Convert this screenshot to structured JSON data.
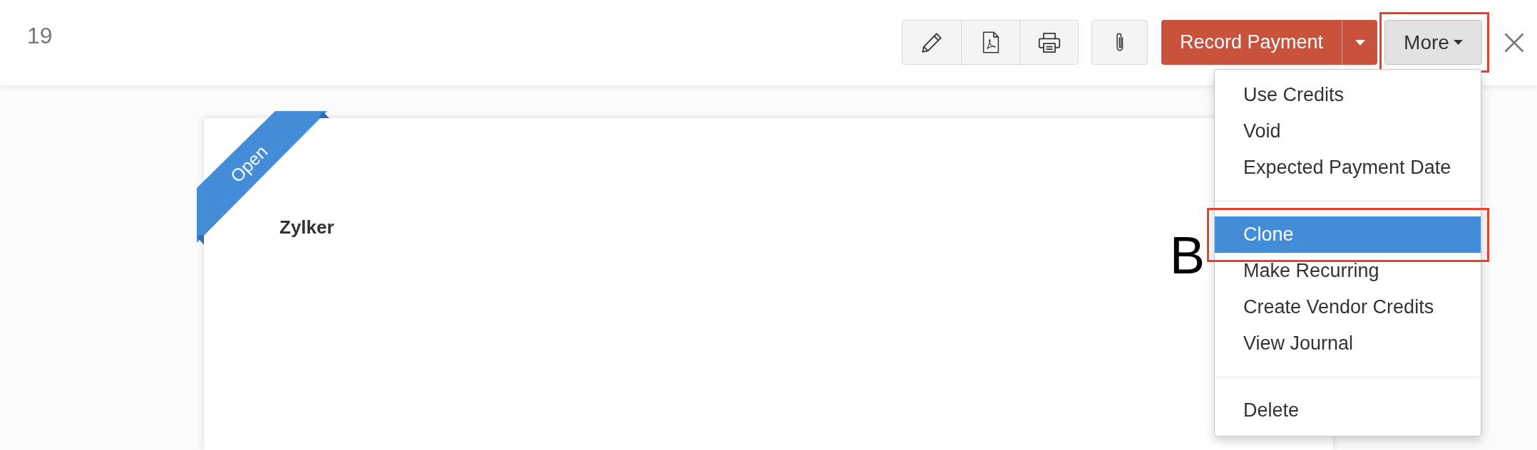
{
  "header": {
    "title": "19"
  },
  "actions": {
    "record_payment": {
      "label": "Record Payment"
    },
    "more": {
      "label": "More",
      "highlighted": true
    }
  },
  "more_menu": {
    "sections": [
      {
        "items": [
          {
            "label": "Use Credits",
            "selected": false,
            "highlighted": false
          },
          {
            "label": "Void",
            "selected": false,
            "highlighted": false
          },
          {
            "label": "Expected Payment Date",
            "selected": false,
            "highlighted": false
          }
        ]
      },
      {
        "items": [
          {
            "label": "Clone",
            "selected": true,
            "highlighted": true,
            "callout": "B"
          },
          {
            "label": "Make Recurring",
            "selected": false,
            "highlighted": false
          },
          {
            "label": "Create Vendor Credits",
            "selected": false,
            "highlighted": false
          },
          {
            "label": "View Journal",
            "selected": false,
            "highlighted": false
          }
        ]
      },
      {
        "items": [
          {
            "label": "Delete",
            "selected": false,
            "highlighted": false
          }
        ]
      }
    ]
  },
  "document": {
    "status": "Open",
    "vendor": "Zylker"
  }
}
